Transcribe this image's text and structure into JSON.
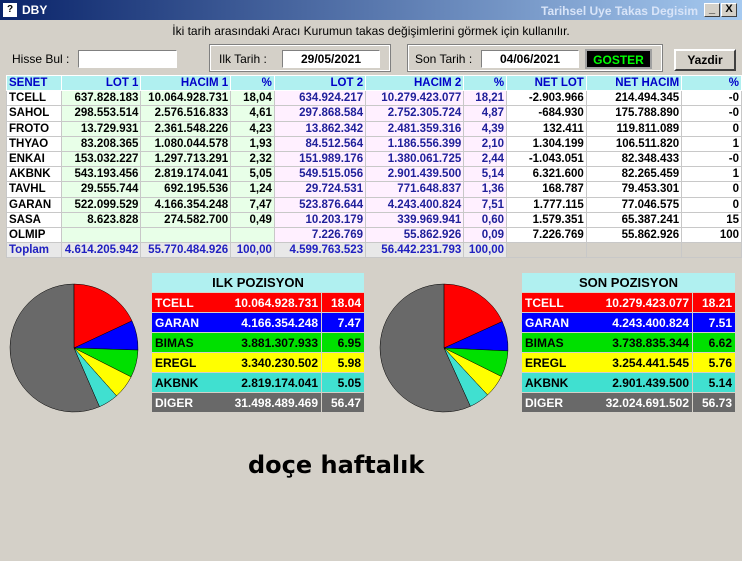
{
  "window": {
    "title": "DBY",
    "right_title": "Tarihsel Uye Takas Degisim",
    "min": "_",
    "close": "X"
  },
  "hint": "İki tarih arasındaki  Aracı Kurumun takas değişimlerini görmek için kullanılır.",
  "form": {
    "hisse_label": "Hisse Bul :",
    "hisse_value": "",
    "ilk_label": "Ilk Tarih :",
    "ilk_value": "29/05/2021",
    "son_label": "Son Tarih :",
    "son_value": "04/06/2021",
    "goster": "GOSTER",
    "yazdir": "Yazdir"
  },
  "grid": {
    "headers": [
      "SENET",
      "LOT 1",
      "HACIM 1",
      "%",
      "LOT 2",
      "HACIM 2",
      "%",
      "NET LOT",
      "NET HACIM",
      "%"
    ],
    "rows": [
      [
        "TCELL",
        "637.828.183",
        "10.064.928.731",
        "18,04",
        "634.924.217",
        "10.279.423.077",
        "18,21",
        "-2.903.966",
        "214.494.345",
        "-0"
      ],
      [
        "SAHOL",
        "298.553.514",
        "2.576.516.833",
        "4,61",
        "297.868.584",
        "2.752.305.724",
        "4,87",
        "-684.930",
        "175.788.890",
        "-0"
      ],
      [
        "FROTO",
        "13.729.931",
        "2.361.548.226",
        "4,23",
        "13.862.342",
        "2.481.359.316",
        "4,39",
        "132.411",
        "119.811.089",
        "0"
      ],
      [
        "THYAO",
        "83.208.365",
        "1.080.044.578",
        "1,93",
        "84.512.564",
        "1.186.556.399",
        "2,10",
        "1.304.199",
        "106.511.820",
        "1"
      ],
      [
        "ENKAI",
        "153.032.227",
        "1.297.713.291",
        "2,32",
        "151.989.176",
        "1.380.061.725",
        "2,44",
        "-1.043.051",
        "82.348.433",
        "-0"
      ],
      [
        "AKBNK",
        "543.193.456",
        "2.819.174.041",
        "5,05",
        "549.515.056",
        "2.901.439.500",
        "5,14",
        "6.321.600",
        "82.265.459",
        "1"
      ],
      [
        "TAVHL",
        "29.555.744",
        "692.195.536",
        "1,24",
        "29.724.531",
        "771.648.837",
        "1,36",
        "168.787",
        "79.453.301",
        "0"
      ],
      [
        "GARAN",
        "522.099.529",
        "4.166.354.248",
        "7,47",
        "523.876.644",
        "4.243.400.824",
        "7,51",
        "1.777.115",
        "77.046.575",
        "0"
      ],
      [
        "SASA",
        "8.623.828",
        "274.582.700",
        "0,49",
        "10.203.179",
        "339.969.941",
        "0,60",
        "1.579.351",
        "65.387.241",
        "15"
      ],
      [
        "OLMIP",
        "",
        "",
        "",
        "7.226.769",
        "55.862.926",
        "0,09",
        "7.226.769",
        "55.862.926",
        "100"
      ]
    ],
    "total": [
      "Toplam",
      "4.614.205.942",
      "55.770.484.926",
      "100,00",
      "4.599.763.523",
      "56.442.231.793",
      "100,00",
      "",
      "",
      ""
    ]
  },
  "ilk_pozisyon": {
    "title": "ILK POZISYON",
    "rows": [
      {
        "name": "TCELL",
        "value": "10.064.928.731",
        "pct": "18.04",
        "share": 18.04,
        "bg": "#ff0000",
        "fg": "#ffffff"
      },
      {
        "name": "GARAN",
        "value": "4.166.354.248",
        "pct": "7.47",
        "share": 7.47,
        "bg": "#0000ff",
        "fg": "#ffffff"
      },
      {
        "name": "BIMAS",
        "value": "3.881.307.933",
        "pct": "6.95",
        "share": 6.95,
        "bg": "#00e000",
        "fg": "#000000"
      },
      {
        "name": "EREGL",
        "value": "3.340.230.502",
        "pct": "5.98",
        "share": 5.98,
        "bg": "#ffff00",
        "fg": "#000000"
      },
      {
        "name": "AKBNK",
        "value": "2.819.174.041",
        "pct": "5.05",
        "share": 5.05,
        "bg": "#40e0d0",
        "fg": "#000000"
      },
      {
        "name": "DIGER",
        "value": "31.498.489.469",
        "pct": "56.47",
        "share": 56.47,
        "bg": "#696969",
        "fg": "#ffffff"
      }
    ]
  },
  "son_pozisyon": {
    "title": "SON POZISYON",
    "rows": [
      {
        "name": "TCELL",
        "value": "10.279.423.077",
        "pct": "18.21",
        "share": 18.21,
        "bg": "#ff0000",
        "fg": "#ffffff"
      },
      {
        "name": "GARAN",
        "value": "4.243.400.824",
        "pct": "7.51",
        "share": 7.51,
        "bg": "#0000ff",
        "fg": "#ffffff"
      },
      {
        "name": "BIMAS",
        "value": "3.738.835.344",
        "pct": "6.62",
        "share": 6.62,
        "bg": "#00e000",
        "fg": "#000000"
      },
      {
        "name": "EREGL",
        "value": "3.254.441.545",
        "pct": "5.76",
        "share": 5.76,
        "bg": "#ffff00",
        "fg": "#000000"
      },
      {
        "name": "AKBNK",
        "value": "2.901.439.500",
        "pct": "5.14",
        "share": 5.14,
        "bg": "#40e0d0",
        "fg": "#000000"
      },
      {
        "name": "DIGER",
        "value": "32.024.691.502",
        "pct": "56.73",
        "share": 56.73,
        "bg": "#696969",
        "fg": "#ffffff"
      }
    ]
  },
  "caption": "doçe haftalık"
}
